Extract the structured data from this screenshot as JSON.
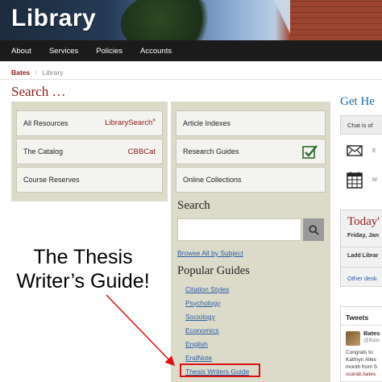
{
  "banner": {
    "title": "Library"
  },
  "nav": {
    "items": [
      {
        "label": "About"
      },
      {
        "label": "Services"
      },
      {
        "label": "Policies"
      },
      {
        "label": "Accounts"
      }
    ]
  },
  "breadcrumb": {
    "home": "Bates",
    "current": "Library"
  },
  "search_section": {
    "title": "Search …"
  },
  "left_tiles": [
    {
      "label": "All Resources",
      "brand": "LibrarySearch",
      "brand_mark": "®"
    },
    {
      "label": "The Catalog",
      "brand": "CBBCat"
    },
    {
      "label": "Course Reserves"
    }
  ],
  "right_tiles": [
    {
      "label": "Article Indexes"
    },
    {
      "label": "Research Guides",
      "icon": "checkbox-checked-icon"
    },
    {
      "label": "Online Collections"
    }
  ],
  "search": {
    "heading": "Search",
    "placeholder": "",
    "button_icon": "search-icon"
  },
  "browse_link": "Browse All by Subject",
  "popular_guides": {
    "heading": "Popular Guides",
    "items": [
      {
        "label": "Citation Styles"
      },
      {
        "label": "Psychology"
      },
      {
        "label": "Sociology"
      },
      {
        "label": "Economics"
      },
      {
        "label": "English"
      },
      {
        "label": "EndNote"
      },
      {
        "label": "Thesis Writers Guide"
      }
    ]
  },
  "get_help": {
    "title": "Get He",
    "chat": "Chat is of",
    "email_label": "E",
    "calendar_label": "M"
  },
  "today": {
    "title": "Today'",
    "date": "Friday, Jan",
    "location": "Ladd Librar",
    "other_link": "Other desk"
  },
  "tweets": {
    "heading": "Tweets",
    "name": "Bates",
    "handle": "@Bate",
    "line1": "Congrats to",
    "line2": "Kathryn Alles",
    "line3": "month from S",
    "link": "scarab.bates"
  },
  "annotation": {
    "line1": "The Thesis",
    "line2": "Writer’s Guide!"
  },
  "colors": {
    "accent": "#8a1a1a",
    "link": "#2a5ca8",
    "panel": "#dcdbca",
    "highlight": "#dd1111"
  }
}
